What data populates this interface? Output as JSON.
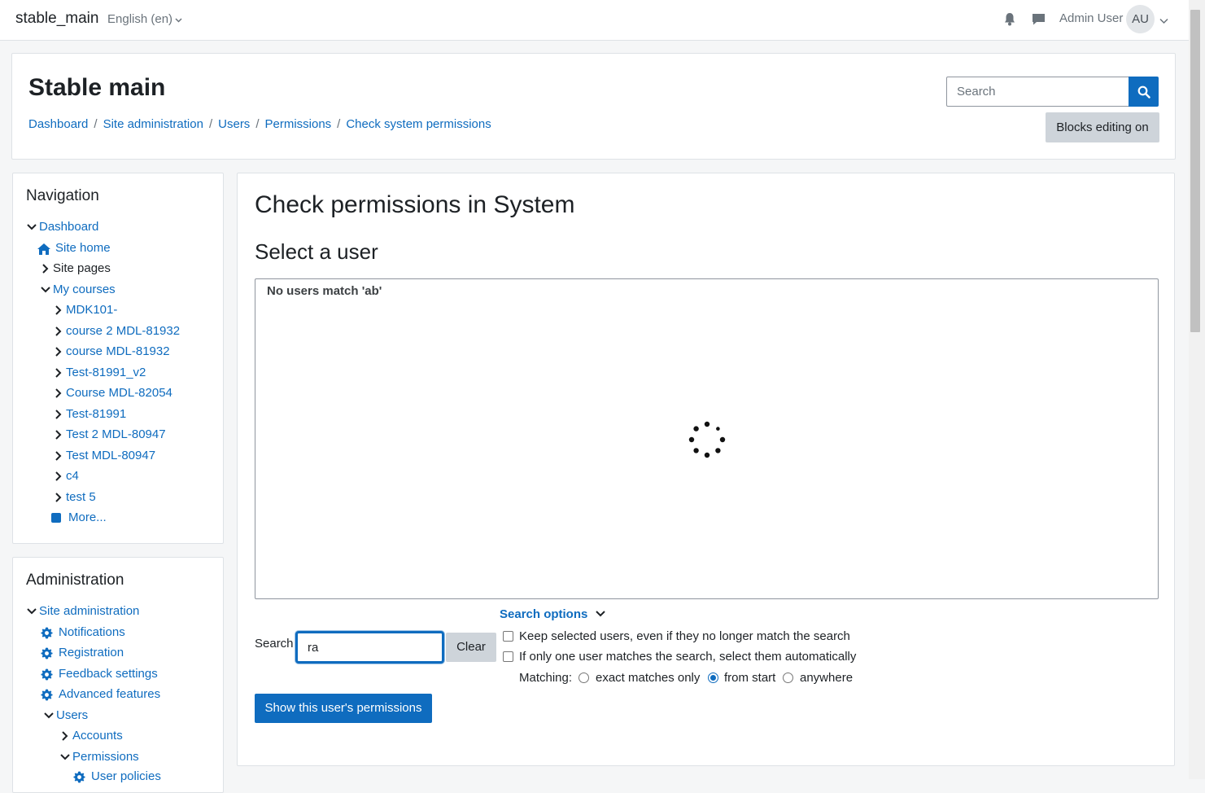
{
  "navbar": {
    "brand": "stable_main",
    "language": "English (en)",
    "user_name": "Admin User",
    "avatar_initials": "AU",
    "icons": [
      "bell-icon",
      "chat-icon",
      "chevron-down-icon"
    ]
  },
  "header": {
    "title": "Stable main",
    "breadcrumb": [
      "Dashboard",
      "Site administration",
      "Users",
      "Permissions",
      "Check system permissions"
    ],
    "search_placeholder": "Search",
    "blocks_editing_label": "Blocks editing on"
  },
  "navigation": {
    "title": "Navigation",
    "items": [
      {
        "label": "Dashboard",
        "icon": "chevron-down-icon",
        "link": true
      },
      {
        "label": "Site home",
        "icon": "home-icon",
        "link": true
      },
      {
        "label": "Site pages",
        "icon": "chevron-right-icon",
        "link": false
      },
      {
        "label": "My courses",
        "icon": "chevron-down-icon",
        "link": true
      },
      {
        "label": "MDK101-",
        "icon": "chevron-right-icon",
        "link": true
      },
      {
        "label": "course 2 MDL-81932",
        "icon": "chevron-right-icon",
        "link": true
      },
      {
        "label": "course MDL-81932",
        "icon": "chevron-right-icon",
        "link": true
      },
      {
        "label": "Test-81991_v2",
        "icon": "chevron-right-icon",
        "link": true
      },
      {
        "label": "Course MDL-82054",
        "icon": "chevron-right-icon",
        "link": true
      },
      {
        "label": "Test-81991",
        "icon": "chevron-right-icon",
        "link": true
      },
      {
        "label": "Test 2 MDL-80947",
        "icon": "chevron-right-icon",
        "link": true
      },
      {
        "label": "Test MDL-80947",
        "icon": "chevron-right-icon",
        "link": true
      },
      {
        "label": "c4",
        "icon": "chevron-right-icon",
        "link": true
      },
      {
        "label": "test 5",
        "icon": "chevron-right-icon",
        "link": true
      },
      {
        "label": "More...",
        "icon": "square-icon",
        "link": true
      }
    ]
  },
  "administration": {
    "title": "Administration",
    "items": [
      {
        "label": "Site administration",
        "icon": "chevron-down-icon"
      },
      {
        "label": "Notifications",
        "icon": "gear-icon"
      },
      {
        "label": "Registration",
        "icon": "gear-icon"
      },
      {
        "label": "Feedback settings",
        "icon": "gear-icon"
      },
      {
        "label": "Advanced features",
        "icon": "gear-icon"
      },
      {
        "label": "Users",
        "icon": "chevron-down-icon"
      },
      {
        "label": "Accounts",
        "icon": "chevron-right-icon"
      },
      {
        "label": "Permissions",
        "icon": "chevron-down-icon"
      },
      {
        "label": "User policies",
        "icon": "gear-icon"
      }
    ]
  },
  "main": {
    "title": "Check permissions in System",
    "subtitle": "Select a user",
    "no_match_text": "No users match 'ab'",
    "search_label": "Search",
    "search_value": "ra",
    "clear_label": "Clear",
    "search_options_label": "Search options",
    "keep_selected_label": "Keep selected users, even if they no longer match the search",
    "auto_select_label": "If only one user matches the search, select them automatically",
    "matching_label": "Matching:",
    "match_exact_label": "exact matches only",
    "match_start_label": "from start",
    "match_anywhere_label": "anywhere",
    "selected_matching": "from start",
    "show_button_label": "Show this user's permissions"
  },
  "colors": {
    "accent": "#0f6cbf",
    "text": "#1d2125",
    "muted": "#6a737b",
    "secondary_button": "#ced4da"
  }
}
